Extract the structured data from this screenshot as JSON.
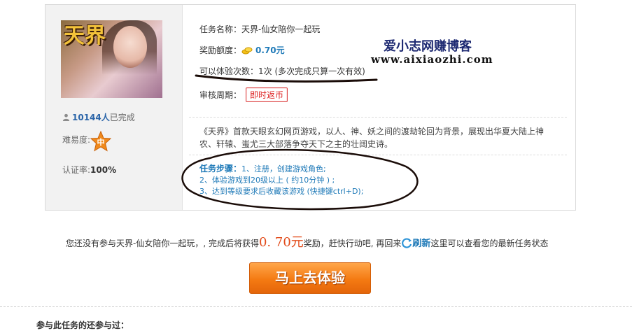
{
  "task": {
    "name_label": "任务名称：",
    "name_value": "天界-仙女陪你一起玩",
    "reward_label": "奖励额度：",
    "reward_value": "0.70元",
    "times_label": "可以体验次数：",
    "times_value": "1次 (多次完成只算一次有效)",
    "review_label": "审核周期：",
    "review_badge": "即时返币",
    "description": "《天界》首款天眼玄幻网页游戏，以人、神、妖之间的渡劫轮回为背景，展现出华夏大陆上神农、轩辕、蚩尤三大部落争夺天下之主的壮阔史诗。",
    "steps_title": "任务步骤：",
    "step1": "1、注册，创建游戏角色;",
    "step2": "2、体验游戏到20级以上 ( 约10分钟 ) ;",
    "step3": "3、达到等级要求后收藏该游戏 (快捷键ctrl+D);"
  },
  "left": {
    "cover_logo": "天界",
    "completed_count": "10144人",
    "completed_suffix": "已完成",
    "difficulty_label": "难易度:",
    "difficulty_value": "中",
    "cert_label": "认证率:",
    "cert_value": "100%"
  },
  "watermark": {
    "line1": "爱小志网赚博客",
    "line2": "www.aixiaozhi.com"
  },
  "notice": {
    "part1": "您还没有参与天界-仙女陪你一起玩，, 完成后将获得",
    "amount": "0. 70元",
    "part2": "奖励，赶快行动吧, 再回来",
    "refresh": "刷新",
    "part3": "这里可以查看您的最新任务状态"
  },
  "cta_label": "马上去体验",
  "also_label": "参与此任务的还参与过：",
  "colors": {
    "accent_blue": "#1f7ab8",
    "cta_orange": "#f47a12",
    "badge_red": "#d22"
  }
}
